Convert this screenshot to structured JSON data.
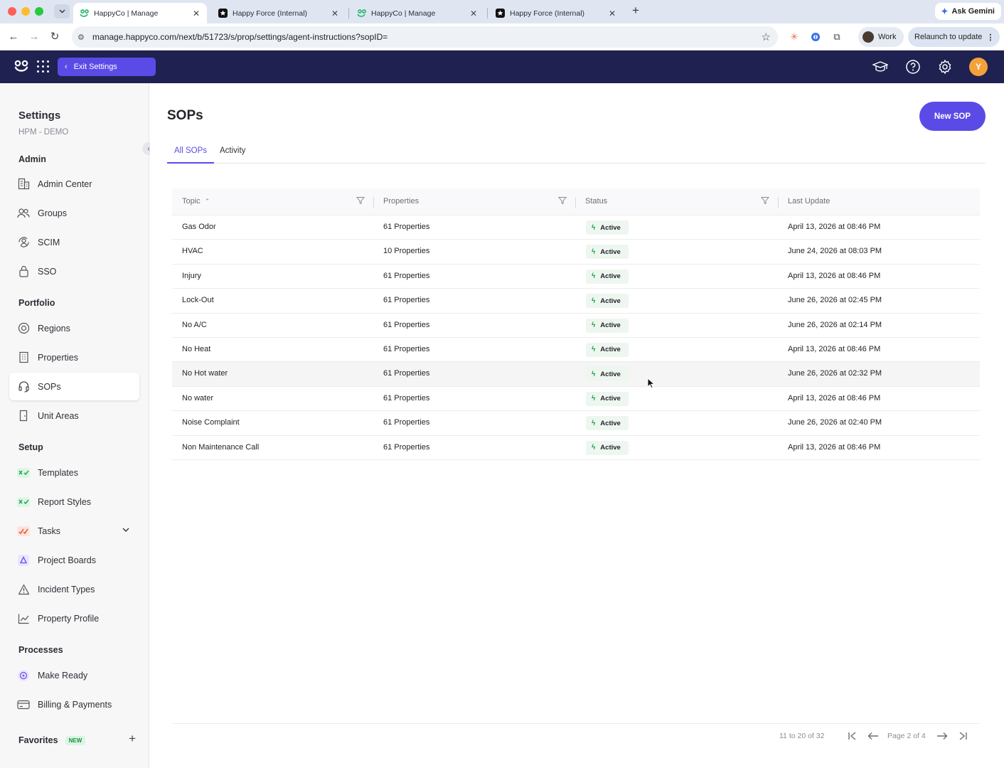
{
  "browser": {
    "tabs": [
      {
        "title": "HappyCo | Manage",
        "active": true,
        "favicon": "happyco-icon"
      },
      {
        "title": "Happy Force (Internal)",
        "active": false,
        "favicon": "happyforce-icon"
      },
      {
        "title": "HappyCo | Manage",
        "active": false,
        "favicon": "happyco-icon"
      },
      {
        "title": "Happy Force (Internal)",
        "active": false,
        "favicon": "happyforce-icon"
      }
    ],
    "gemini_label": "Ask Gemini",
    "url": "manage.happyco.com/next/b/51723/s/prop/settings/agent-instructions?sopID=",
    "profile_label": "Work",
    "relaunch_label": "Relaunch to update"
  },
  "header": {
    "exit_label": "Exit Settings",
    "avatar_initial": "Y",
    "colors": {
      "bar": "#1f2150",
      "accent": "#5b4be6",
      "avatar": "#f3a23a"
    }
  },
  "sidebar": {
    "title": "Settings",
    "subtitle": "HPM - DEMO",
    "sections": {
      "admin": "Admin",
      "portfolio": "Portfolio",
      "setup": "Setup",
      "processes": "Processes"
    },
    "items": {
      "admin_center": "Admin Center",
      "groups": "Groups",
      "scim": "SCIM",
      "sso": "SSO",
      "regions": "Regions",
      "properties": "Properties",
      "sops": "SOPs",
      "unit_areas": "Unit Areas",
      "templates": "Templates",
      "report_styles": "Report Styles",
      "tasks": "Tasks",
      "project_boards": "Project Boards",
      "incident_types": "Incident Types",
      "property_profile": "Property Profile",
      "make_ready": "Make Ready",
      "billing_payments": "Billing & Payments"
    },
    "favorites_label": "Favorites",
    "favorites_badge": "NEW"
  },
  "main": {
    "title": "SOPs",
    "new_button": "New SOP",
    "tabs": [
      "All SOPs",
      "Activity"
    ],
    "columns": [
      "Topic",
      "Properties",
      "Status",
      "Last Update"
    ],
    "rows": [
      {
        "topic": "Gas Odor",
        "properties": "61 Properties",
        "status": "Active",
        "updated": "April 13, 2026 at 08:46 PM"
      },
      {
        "topic": "HVAC",
        "properties": "10 Properties",
        "status": "Active",
        "updated": "June 24, 2026 at 08:03 PM"
      },
      {
        "topic": "Injury",
        "properties": "61 Properties",
        "status": "Active",
        "updated": "April 13, 2026 at 08:46 PM"
      },
      {
        "topic": "Lock-Out",
        "properties": "61 Properties",
        "status": "Active",
        "updated": "June 26, 2026 at 02:45 PM"
      },
      {
        "topic": "No A/C",
        "properties": "61 Properties",
        "status": "Active",
        "updated": "June 26, 2026 at 02:14 PM"
      },
      {
        "topic": "No Heat",
        "properties": "61 Properties",
        "status": "Active",
        "updated": "April 13, 2026 at 08:46 PM"
      },
      {
        "topic": "No Hot water",
        "properties": "61 Properties",
        "status": "Active",
        "updated": "June 26, 2026 at 02:32 PM"
      },
      {
        "topic": "No water",
        "properties": "61 Properties",
        "status": "Active",
        "updated": "April 13, 2026 at 08:46 PM"
      },
      {
        "topic": "Noise Complaint",
        "properties": "61 Properties",
        "status": "Active",
        "updated": "June 26, 2026 at 02:40 PM"
      },
      {
        "topic": "Non Maintenance Call",
        "properties": "61 Properties",
        "status": "Active",
        "updated": "April 13, 2026 at 08:46 PM"
      }
    ],
    "pagination": {
      "range": "11 to 20 of 32",
      "page": "Page 2 of 4"
    }
  }
}
